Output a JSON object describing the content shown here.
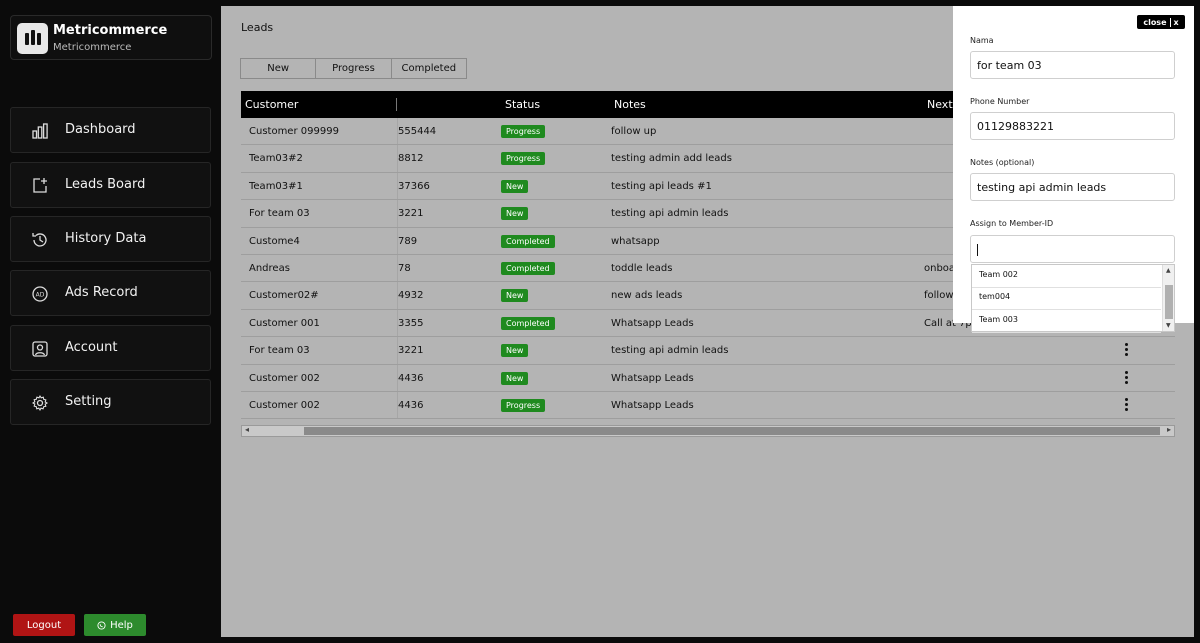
{
  "brand": {
    "title": "Metricommerce",
    "subtitle": "Metricommerce"
  },
  "sidebar": {
    "items": [
      {
        "label": "Dashboard",
        "icon": "bar-chart-icon"
      },
      {
        "label": "Leads Board",
        "icon": "add-board-icon"
      },
      {
        "label": "History Data",
        "icon": "history-icon"
      },
      {
        "label": "Ads Record",
        "icon": "ads-icon"
      },
      {
        "label": "Account",
        "icon": "account-icon"
      },
      {
        "label": "Setting",
        "icon": "gear-icon"
      }
    ],
    "logout_label": "Logout",
    "help_label": "Help"
  },
  "main": {
    "title": "Leads",
    "tabs": [
      "New",
      "Progress",
      "Completed"
    ],
    "table": {
      "headers": {
        "customer": "Customer",
        "status": "Status",
        "notes": "Notes",
        "next": "Next"
      },
      "rows": [
        {
          "customer": "Customer 099999",
          "phone": "555444",
          "status": "Progress",
          "notes": "follow up",
          "next": ""
        },
        {
          "customer": "Team03#2",
          "phone": "8812",
          "status": "Progress",
          "notes": "testing admin add leads",
          "next": ""
        },
        {
          "customer": "Team03#1",
          "phone": "37366",
          "status": "New",
          "notes": "testing api leads #1",
          "next": ""
        },
        {
          "customer": "For team 03",
          "phone": "3221",
          "status": "New",
          "notes": "testing api admin leads",
          "next": ""
        },
        {
          "customer": "Custome4",
          "phone": "789",
          "status": "Completed",
          "notes": "whatsapp",
          "next": ""
        },
        {
          "customer": "Andreas",
          "phone": "78",
          "status": "Completed",
          "notes": "toddle leads",
          "next": "onboa"
        },
        {
          "customer": "Customer02#",
          "phone": "4932",
          "status": "New",
          "notes": "new ads leads",
          "next": "followu"
        },
        {
          "customer": "Customer 001",
          "phone": "3355",
          "status": "Completed",
          "notes": "Whatsapp Leads",
          "next": "Call at 7pi"
        },
        {
          "customer": "For team 03",
          "phone": "3221",
          "status": "New",
          "notes": "testing api admin leads",
          "next": ""
        },
        {
          "customer": "Customer 002",
          "phone": "4436",
          "status": "New",
          "notes": "Whatsapp Leads",
          "next": ""
        },
        {
          "customer": "Customer 002",
          "phone": "4436",
          "status": "Progress",
          "notes": "Whatsapp Leads",
          "next": ""
        }
      ]
    }
  },
  "colors": {
    "status_new": "#1f8a1f",
    "status_progress": "#1f8a1f",
    "status_completed": "#1f8a1f",
    "logout": "#b01414",
    "help": "#2d8b2d"
  },
  "drawer": {
    "close_label": "close",
    "close_x": "x",
    "name_label": "Nama",
    "name_value": "for team 03",
    "phone_label": "Phone Number",
    "phone_value": "01129883221",
    "notes_label": "Notes (optional)",
    "notes_value": "testing api admin leads",
    "assign_label": "Assign to Member-ID",
    "assign_value": "",
    "options": [
      "Team 002",
      "tem004",
      "Team 003"
    ]
  }
}
